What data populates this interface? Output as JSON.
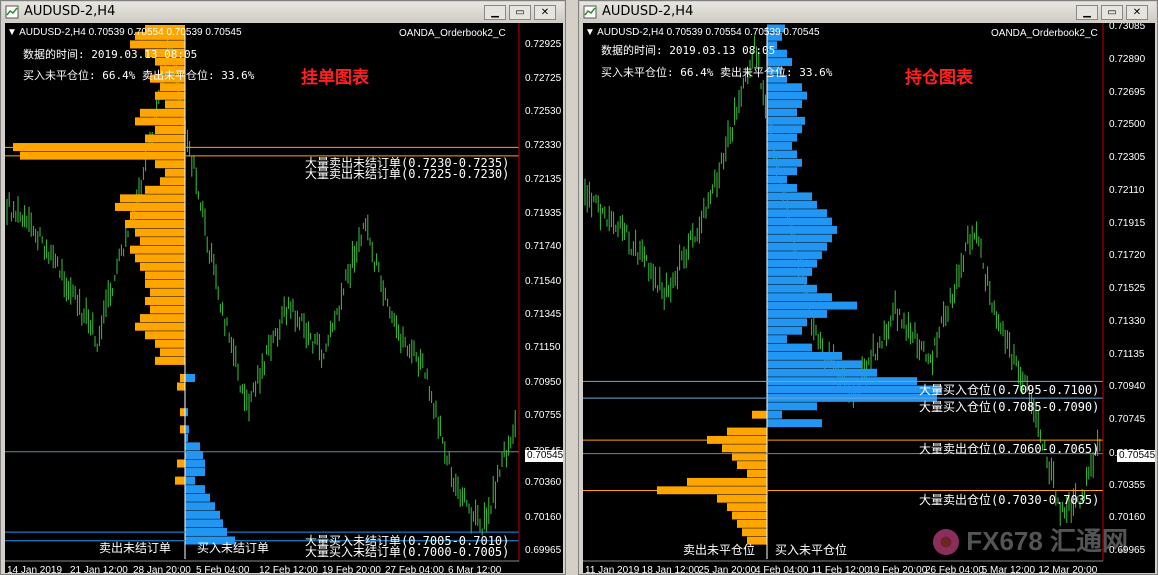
{
  "left_window": {
    "title": "AUDUSD-2,H4",
    "header": {
      "symbol_line": "AUDUSD-2,H4  0.70539 0.70554 0.70539 0.70545",
      "indicator": "OANDA_Orderbook2_C",
      "data_time": "数据的时间: 2019.03.13 08:05",
      "ratio": "买入未平仓位: 66.4% 卖出未平仓位: 33.6%",
      "chart_label": "挂单图表"
    },
    "levels": [
      "大量卖出未结订单(0.7230-0.7235)",
      "大量卖出未结订单(0.7225-0.7230)",
      "大量买入未结订单(0.7005-0.7010)",
      "大量买入未结订单(0.7000-0.7005)"
    ],
    "bottom_labels": {
      "sell": "卖出未结订单",
      "buy": "买入未结订单"
    },
    "price_ticks": [
      "0.72925",
      "0.72725",
      "0.72530",
      "0.72330",
      "0.72135",
      "0.71935",
      "0.71740",
      "0.71540",
      "0.71345",
      "0.71150",
      "0.70950",
      "0.70755",
      "0.70545",
      "0.70360",
      "0.70160",
      "0.69965"
    ],
    "current_price": "0.70545",
    "time_ticks": [
      "14 Jan 2019",
      "21 Jan 12:00",
      "28 Jan 20:00",
      "5 Feb 04:00",
      "12 Feb 12:00",
      "19 Feb 20:00",
      "27 Feb 04:00",
      "6 Mar 12:00"
    ],
    "chart_data": {
      "type": "bar",
      "price_range": [
        0.69965,
        0.73005
      ],
      "sell_bars_left": [
        [
          0.7299,
          40
        ],
        [
          0.7295,
          50
        ],
        [
          0.729,
          55
        ],
        [
          0.7285,
          40
        ],
        [
          0.728,
          30
        ],
        [
          0.7275,
          25
        ],
        [
          0.727,
          35
        ],
        [
          0.7265,
          25
        ],
        [
          0.726,
          30
        ],
        [
          0.7255,
          20
        ],
        [
          0.725,
          45
        ],
        [
          0.7245,
          50
        ],
        [
          0.724,
          30
        ],
        [
          0.7235,
          40
        ],
        [
          0.723,
          172
        ],
        [
          0.7225,
          165
        ],
        [
          0.722,
          30
        ],
        [
          0.7215,
          20
        ],
        [
          0.721,
          25
        ],
        [
          0.7205,
          40
        ],
        [
          0.72,
          65
        ],
        [
          0.7195,
          70
        ],
        [
          0.719,
          55
        ],
        [
          0.7185,
          60
        ],
        [
          0.718,
          50
        ],
        [
          0.7175,
          45
        ],
        [
          0.717,
          55
        ],
        [
          0.7165,
          50
        ],
        [
          0.716,
          45
        ],
        [
          0.7155,
          40
        ],
        [
          0.715,
          40
        ],
        [
          0.7145,
          35
        ],
        [
          0.714,
          40
        ],
        [
          0.7135,
          35
        ],
        [
          0.713,
          45
        ],
        [
          0.7125,
          50
        ],
        [
          0.712,
          40
        ],
        [
          0.7115,
          30
        ],
        [
          0.711,
          25
        ],
        [
          0.7105,
          30
        ],
        [
          0.71,
          0
        ],
        [
          0.7095,
          5
        ],
        [
          0.709,
          8
        ],
        [
          0.7085,
          0
        ],
        [
          0.708,
          0
        ],
        [
          0.7075,
          5
        ],
        [
          0.707,
          0
        ],
        [
          0.7065,
          5
        ],
        [
          0.706,
          0
        ],
        [
          0.705,
          0
        ],
        [
          0.7045,
          8
        ],
        [
          0.704,
          0
        ],
        [
          0.7035,
          10
        ]
      ],
      "buy_bars_right": [
        [
          0.7095,
          10
        ],
        [
          0.7075,
          3
        ],
        [
          0.7065,
          4
        ],
        [
          0.706,
          3
        ],
        [
          0.7055,
          15
        ],
        [
          0.705,
          18
        ],
        [
          0.7045,
          20
        ],
        [
          0.704,
          20
        ],
        [
          0.7035,
          10
        ],
        [
          0.703,
          20
        ],
        [
          0.7025,
          25
        ],
        [
          0.702,
          30
        ],
        [
          0.7015,
          35
        ],
        [
          0.701,
          38
        ],
        [
          0.7005,
          42
        ],
        [
          0.7,
          50
        ]
      ]
    }
  },
  "right_window": {
    "title": "AUDUSD-2,H4",
    "header": {
      "symbol_line": "AUDUSD-2,H4  0.70539 0.70554 0.70539 0.70545",
      "indicator": "OANDA_Orderbook2_C",
      "data_time": "数据的时间: 2019.03.13 08:05",
      "ratio": "买入未平仓位: 66.4% 卖出未平仓位: 33.6%",
      "chart_label": "持仓图表"
    },
    "levels": [
      "大量买入仓位(0.7095-0.7100)",
      "大量买入仓位(0.7085-0.7090)",
      "大量卖出仓位(0.7060-0.7065)",
      "大量卖出仓位(0.7030-0.7035)"
    ],
    "bottom_labels": {
      "sell": "卖出未平仓位",
      "buy": "买入未平仓位"
    },
    "price_ticks": [
      "0.73085",
      "0.72890",
      "0.72695",
      "0.72500",
      "0.72305",
      "0.72110",
      "0.71915",
      "0.71720",
      "0.71525",
      "0.71330",
      "0.71135",
      "0.70940",
      "0.70745",
      "0.70545",
      "0.70355",
      "0.70160",
      "0.69965"
    ],
    "current_price": "0.70545",
    "time_ticks": [
      "11 Jan 2019",
      "18 Jan 12:00",
      "25 Jan 20:00",
      "4 Feb 04:00",
      "11 Feb 12:00",
      "19 Feb 20:00",
      "26 Feb 04:00",
      "5 Mar 12:00",
      "12 Mar 20:00"
    ],
    "watermark": "FX678 汇通网",
    "chart_data": {
      "type": "bar",
      "price_range": [
        0.69965,
        0.73085
      ],
      "buy_bars_right": [
        [
          0.7305,
          18
        ],
        [
          0.73,
          15
        ],
        [
          0.7295,
          10
        ],
        [
          0.729,
          20
        ],
        [
          0.7285,
          25
        ],
        [
          0.728,
          15
        ],
        [
          0.7275,
          20
        ],
        [
          0.727,
          35
        ],
        [
          0.7265,
          40
        ],
        [
          0.726,
          35
        ],
        [
          0.7255,
          30
        ],
        [
          0.725,
          38
        ],
        [
          0.7245,
          35
        ],
        [
          0.724,
          30
        ],
        [
          0.7235,
          25
        ],
        [
          0.723,
          30
        ],
        [
          0.7225,
          35
        ],
        [
          0.722,
          30
        ],
        [
          0.7215,
          20
        ],
        [
          0.721,
          30
        ],
        [
          0.7205,
          45
        ],
        [
          0.72,
          50
        ],
        [
          0.7195,
          60
        ],
        [
          0.719,
          65
        ],
        [
          0.7185,
          70
        ],
        [
          0.718,
          65
        ],
        [
          0.7175,
          60
        ],
        [
          0.717,
          55
        ],
        [
          0.7165,
          50
        ],
        [
          0.716,
          45
        ],
        [
          0.7155,
          40
        ],
        [
          0.715,
          50
        ],
        [
          0.7145,
          65
        ],
        [
          0.714,
          90
        ],
        [
          0.7135,
          60
        ],
        [
          0.713,
          40
        ],
        [
          0.7125,
          35
        ],
        [
          0.712,
          20
        ],
        [
          0.7115,
          45
        ],
        [
          0.711,
          75
        ],
        [
          0.7105,
          95
        ],
        [
          0.71,
          110
        ],
        [
          0.7095,
          150
        ],
        [
          0.709,
          175
        ],
        [
          0.7085,
          170
        ],
        [
          0.708,
          50
        ],
        [
          0.7075,
          15
        ],
        [
          0.707,
          55
        ],
        [
          0.7065,
          0
        ]
      ],
      "sell_bars_left": [
        [
          0.7075,
          15
        ],
        [
          0.7065,
          40
        ],
        [
          0.706,
          60
        ],
        [
          0.7055,
          45
        ],
        [
          0.705,
          35
        ],
        [
          0.7045,
          30
        ],
        [
          0.704,
          20
        ],
        [
          0.7035,
          80
        ],
        [
          0.703,
          110
        ],
        [
          0.7025,
          50
        ],
        [
          0.702,
          40
        ],
        [
          0.7015,
          35
        ],
        [
          0.701,
          30
        ],
        [
          0.7005,
          25
        ],
        [
          0.7,
          20
        ]
      ]
    }
  }
}
